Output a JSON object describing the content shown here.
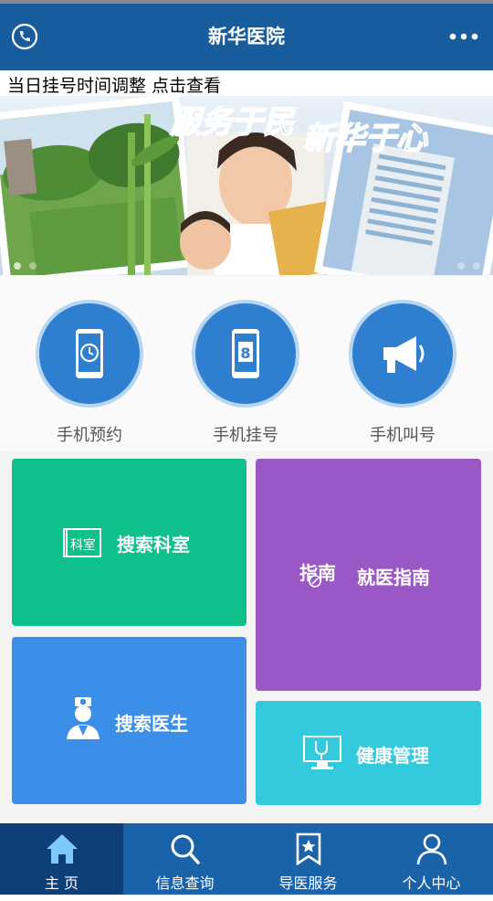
{
  "header": {
    "title": "新华医院"
  },
  "notice": {
    "text": "当日挂号时间调整 点击查看"
  },
  "banner": {
    "headline_left": "服务于民",
    "headline_right": "新华于心"
  },
  "quick_actions": [
    {
      "label": "手机预约",
      "icon": "clock-phone-icon"
    },
    {
      "label": "手机挂号",
      "icon": "number-phone-icon"
    },
    {
      "label": "手机叫号",
      "icon": "megaphone-icon"
    }
  ],
  "tiles": {
    "search_department": {
      "label": "搜索科室",
      "icon_text": "科室",
      "color": "#10c08c"
    },
    "search_doctor": {
      "label": "搜索医生",
      "color": "#3b8fe8"
    },
    "guide": {
      "label": "就医指南",
      "icon_text": "指南",
      "color": "#9a57c6"
    },
    "health": {
      "label": "健康管理",
      "color": "#34cadd"
    }
  },
  "tabs": [
    {
      "label": "主  页",
      "active": true
    },
    {
      "label": "信息查询",
      "active": false
    },
    {
      "label": "导医服务",
      "active": false
    },
    {
      "label": "个人中心",
      "active": false
    }
  ],
  "colors": {
    "topbar": "#175c9c",
    "tabbar": "#1a63a9",
    "tab_active": "#0f3f79"
  }
}
